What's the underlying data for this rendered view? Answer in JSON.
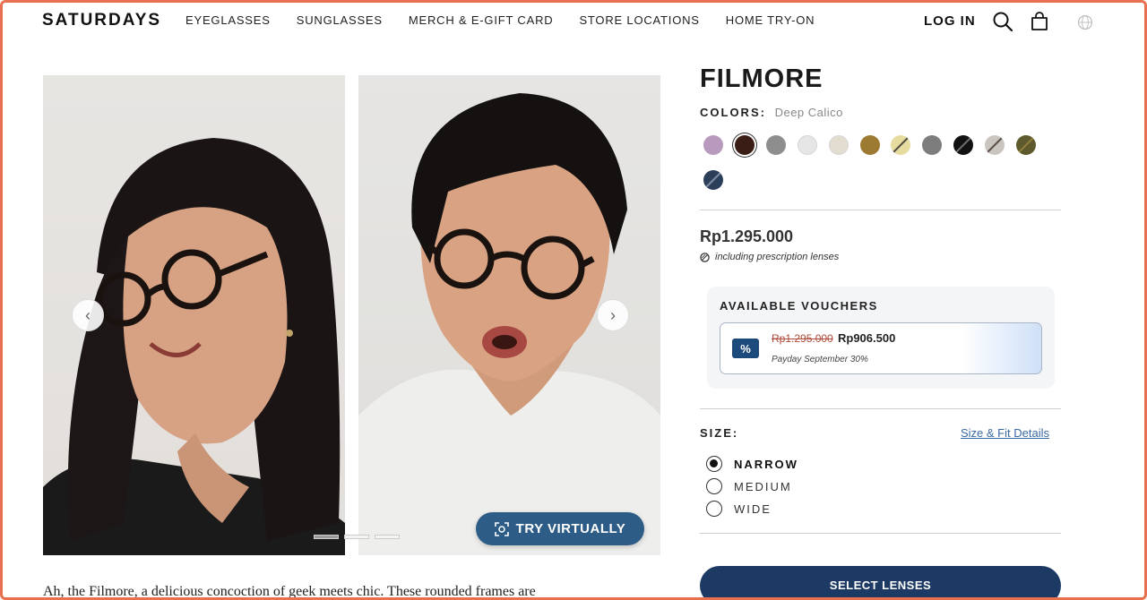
{
  "header": {
    "logo": "SATURDAYS",
    "nav": [
      "EYEGLASSES",
      "SUNGLASSES",
      "MERCH & E-GIFT CARD",
      "STORE LOCATIONS",
      "HOME TRY-ON"
    ],
    "login": "LOG IN",
    "icons": [
      "search-icon",
      "bag-icon",
      "globe-icon"
    ]
  },
  "gallery": {
    "prev_icon": "chevron-left-icon",
    "next_icon": "chevron-right-icon",
    "slides_total": 3,
    "active_slide": 1,
    "try_button": "TRY VIRTUALLY"
  },
  "description": "Ah, the Filmore, a delicious concoction of geek meets chic. These rounded frames are",
  "product": {
    "name": "FILMORE",
    "colors_label": "COLORS:",
    "selected_color": "Deep Calico",
    "swatches": [
      {
        "color": "#b79abe"
      },
      {
        "color": "#3a1d14",
        "selected": true
      },
      {
        "color": "#8e8e8e"
      },
      {
        "color": "#e6e6e6"
      },
      {
        "color": "#e3ddd0"
      },
      {
        "color": "#9c7a32"
      },
      {
        "color": "#e6dca0",
        "accent": "#222222"
      },
      {
        "color": "#7d7d7d"
      },
      {
        "color": "#111111",
        "accent": "#8a8a8a"
      },
      {
        "color": "#c9c6c0",
        "accent": "#3a2a22"
      },
      {
        "color": "#5e5a2e",
        "accent": "#9c8a40"
      },
      {
        "color": "#2b3e5a",
        "accent": "#9aa6b8"
      }
    ],
    "price": "Rp1.295.000",
    "price_note": "including prescription lenses",
    "vouchers": {
      "title": "AVAILABLE VOUCHERS",
      "icon": "%",
      "old_price": "Rp1.295.000",
      "new_price": "Rp906.500",
      "label": "Payday September 30%"
    },
    "size_label": "SIZE:",
    "size_link": "Size & Fit Details",
    "sizes": [
      {
        "label": "NARROW",
        "selected": true
      },
      {
        "label": "MEDIUM",
        "selected": false
      },
      {
        "label": "WIDE",
        "selected": false
      }
    ],
    "select_button": "SELECT LENSES"
  },
  "colors": {
    "accent": "#1c3a63",
    "try_button_bg": "#2d5c87",
    "link": "#3a6aa3",
    "strike": "#b04a3a"
  }
}
